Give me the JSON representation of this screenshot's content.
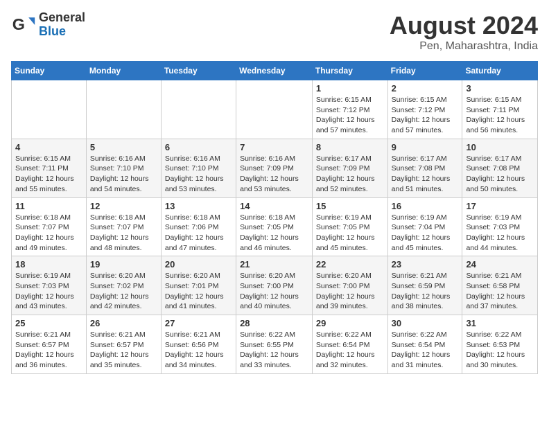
{
  "header": {
    "logo_general": "General",
    "logo_blue": "Blue",
    "month_title": "August 2024",
    "location": "Pen, Maharashtra, India"
  },
  "days_of_week": [
    "Sunday",
    "Monday",
    "Tuesday",
    "Wednesday",
    "Thursday",
    "Friday",
    "Saturday"
  ],
  "weeks": [
    [
      {
        "day": "",
        "info": ""
      },
      {
        "day": "",
        "info": ""
      },
      {
        "day": "",
        "info": ""
      },
      {
        "day": "",
        "info": ""
      },
      {
        "day": "1",
        "info": "Sunrise: 6:15 AM\nSunset: 7:12 PM\nDaylight: 12 hours\nand 57 minutes."
      },
      {
        "day": "2",
        "info": "Sunrise: 6:15 AM\nSunset: 7:12 PM\nDaylight: 12 hours\nand 57 minutes."
      },
      {
        "day": "3",
        "info": "Sunrise: 6:15 AM\nSunset: 7:11 PM\nDaylight: 12 hours\nand 56 minutes."
      }
    ],
    [
      {
        "day": "4",
        "info": "Sunrise: 6:15 AM\nSunset: 7:11 PM\nDaylight: 12 hours\nand 55 minutes."
      },
      {
        "day": "5",
        "info": "Sunrise: 6:16 AM\nSunset: 7:10 PM\nDaylight: 12 hours\nand 54 minutes."
      },
      {
        "day": "6",
        "info": "Sunrise: 6:16 AM\nSunset: 7:10 PM\nDaylight: 12 hours\nand 53 minutes."
      },
      {
        "day": "7",
        "info": "Sunrise: 6:16 AM\nSunset: 7:09 PM\nDaylight: 12 hours\nand 53 minutes."
      },
      {
        "day": "8",
        "info": "Sunrise: 6:17 AM\nSunset: 7:09 PM\nDaylight: 12 hours\nand 52 minutes."
      },
      {
        "day": "9",
        "info": "Sunrise: 6:17 AM\nSunset: 7:08 PM\nDaylight: 12 hours\nand 51 minutes."
      },
      {
        "day": "10",
        "info": "Sunrise: 6:17 AM\nSunset: 7:08 PM\nDaylight: 12 hours\nand 50 minutes."
      }
    ],
    [
      {
        "day": "11",
        "info": "Sunrise: 6:18 AM\nSunset: 7:07 PM\nDaylight: 12 hours\nand 49 minutes."
      },
      {
        "day": "12",
        "info": "Sunrise: 6:18 AM\nSunset: 7:07 PM\nDaylight: 12 hours\nand 48 minutes."
      },
      {
        "day": "13",
        "info": "Sunrise: 6:18 AM\nSunset: 7:06 PM\nDaylight: 12 hours\nand 47 minutes."
      },
      {
        "day": "14",
        "info": "Sunrise: 6:18 AM\nSunset: 7:05 PM\nDaylight: 12 hours\nand 46 minutes."
      },
      {
        "day": "15",
        "info": "Sunrise: 6:19 AM\nSunset: 7:05 PM\nDaylight: 12 hours\nand 45 minutes."
      },
      {
        "day": "16",
        "info": "Sunrise: 6:19 AM\nSunset: 7:04 PM\nDaylight: 12 hours\nand 45 minutes."
      },
      {
        "day": "17",
        "info": "Sunrise: 6:19 AM\nSunset: 7:03 PM\nDaylight: 12 hours\nand 44 minutes."
      }
    ],
    [
      {
        "day": "18",
        "info": "Sunrise: 6:19 AM\nSunset: 7:03 PM\nDaylight: 12 hours\nand 43 minutes."
      },
      {
        "day": "19",
        "info": "Sunrise: 6:20 AM\nSunset: 7:02 PM\nDaylight: 12 hours\nand 42 minutes."
      },
      {
        "day": "20",
        "info": "Sunrise: 6:20 AM\nSunset: 7:01 PM\nDaylight: 12 hours\nand 41 minutes."
      },
      {
        "day": "21",
        "info": "Sunrise: 6:20 AM\nSunset: 7:00 PM\nDaylight: 12 hours\nand 40 minutes."
      },
      {
        "day": "22",
        "info": "Sunrise: 6:20 AM\nSunset: 7:00 PM\nDaylight: 12 hours\nand 39 minutes."
      },
      {
        "day": "23",
        "info": "Sunrise: 6:21 AM\nSunset: 6:59 PM\nDaylight: 12 hours\nand 38 minutes."
      },
      {
        "day": "24",
        "info": "Sunrise: 6:21 AM\nSunset: 6:58 PM\nDaylight: 12 hours\nand 37 minutes."
      }
    ],
    [
      {
        "day": "25",
        "info": "Sunrise: 6:21 AM\nSunset: 6:57 PM\nDaylight: 12 hours\nand 36 minutes."
      },
      {
        "day": "26",
        "info": "Sunrise: 6:21 AM\nSunset: 6:57 PM\nDaylight: 12 hours\nand 35 minutes."
      },
      {
        "day": "27",
        "info": "Sunrise: 6:21 AM\nSunset: 6:56 PM\nDaylight: 12 hours\nand 34 minutes."
      },
      {
        "day": "28",
        "info": "Sunrise: 6:22 AM\nSunset: 6:55 PM\nDaylight: 12 hours\nand 33 minutes."
      },
      {
        "day": "29",
        "info": "Sunrise: 6:22 AM\nSunset: 6:54 PM\nDaylight: 12 hours\nand 32 minutes."
      },
      {
        "day": "30",
        "info": "Sunrise: 6:22 AM\nSunset: 6:54 PM\nDaylight: 12 hours\nand 31 minutes."
      },
      {
        "day": "31",
        "info": "Sunrise: 6:22 AM\nSunset: 6:53 PM\nDaylight: 12 hours\nand 30 minutes."
      }
    ]
  ]
}
